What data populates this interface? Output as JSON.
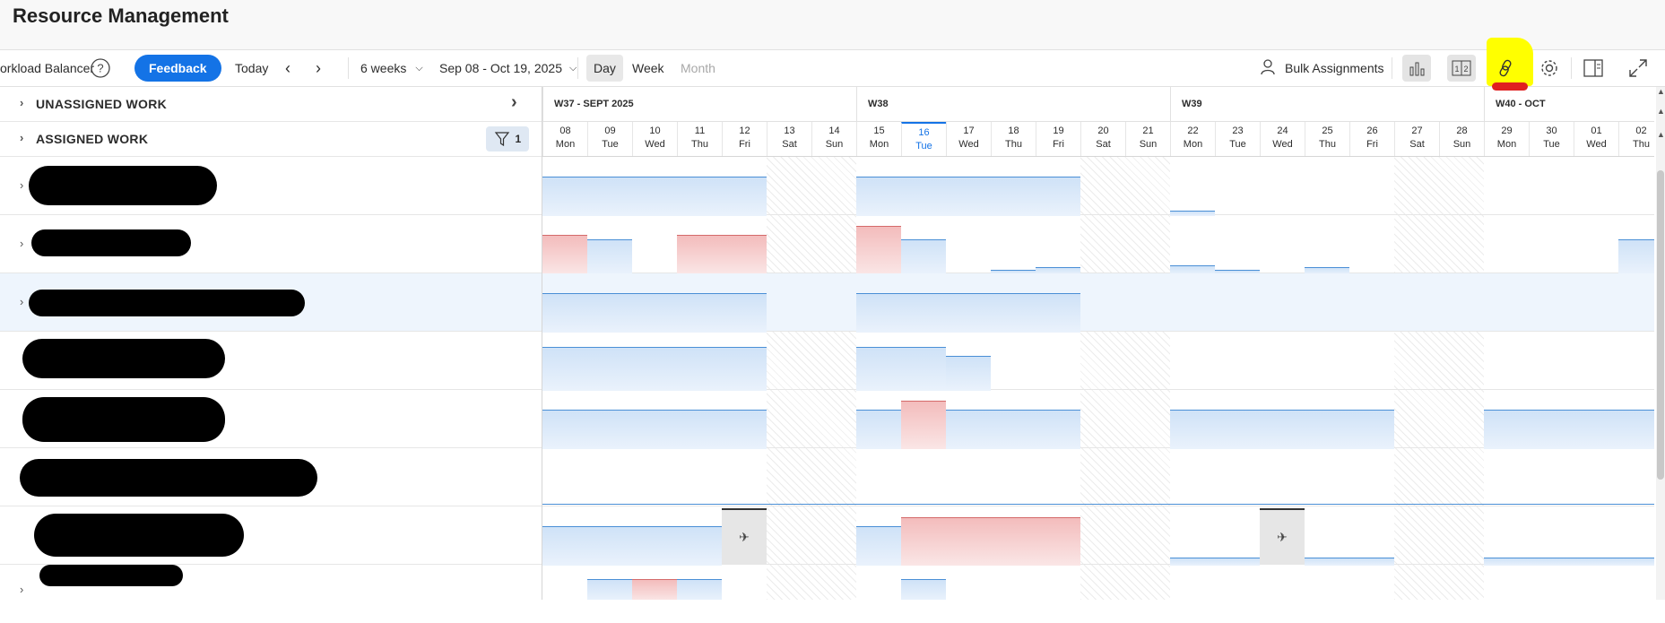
{
  "app": {
    "title": "Resource Management"
  },
  "toolbar": {
    "workload_balancer": "orkload Balancer",
    "feedback": "Feedback",
    "today": "Today",
    "range_select": "6 weeks",
    "date_range": "Sep 08 - Oct 19, 2025",
    "view_day": "Day",
    "view_week": "Week",
    "view_month": "Month",
    "bulk_assignments": "Bulk Assignments"
  },
  "sections": {
    "unassigned": "UNASSIGNED WORK",
    "assigned": "ASSIGNED WORK",
    "filter_count": "1"
  },
  "weeks": [
    {
      "label": "W37 - SEPT 2025"
    },
    {
      "label": "W38"
    },
    {
      "label": "W39"
    },
    {
      "label": "W40 - OCT"
    }
  ],
  "days": [
    {
      "num": "08",
      "dow": "Mon"
    },
    {
      "num": "09",
      "dow": "Tue"
    },
    {
      "num": "10",
      "dow": "Wed"
    },
    {
      "num": "11",
      "dow": "Thu"
    },
    {
      "num": "12",
      "dow": "Fri"
    },
    {
      "num": "13",
      "dow": "Sat"
    },
    {
      "num": "14",
      "dow": "Sun"
    },
    {
      "num": "15",
      "dow": "Mon"
    },
    {
      "num": "16",
      "dow": "Tue"
    },
    {
      "num": "17",
      "dow": "Wed"
    },
    {
      "num": "18",
      "dow": "Thu"
    },
    {
      "num": "19",
      "dow": "Fri"
    },
    {
      "num": "20",
      "dow": "Sat"
    },
    {
      "num": "21",
      "dow": "Sun"
    },
    {
      "num": "22",
      "dow": "Mon"
    },
    {
      "num": "23",
      "dow": "Tue"
    },
    {
      "num": "24",
      "dow": "Wed"
    },
    {
      "num": "25",
      "dow": "Thu"
    },
    {
      "num": "26",
      "dow": "Fri"
    },
    {
      "num": "27",
      "dow": "Sat"
    },
    {
      "num": "28",
      "dow": "Sun"
    },
    {
      "num": "29",
      "dow": "Mon"
    },
    {
      "num": "30",
      "dow": "Tue"
    },
    {
      "num": "01",
      "dow": "Wed"
    },
    {
      "num": "02",
      "dow": "Thu"
    }
  ],
  "today_index": 8,
  "colors": {
    "accent": "#1473e6",
    "overallocated": "#f3bcbc",
    "allocated": "#cfe2f7",
    "highlight": "#ffff00"
  }
}
